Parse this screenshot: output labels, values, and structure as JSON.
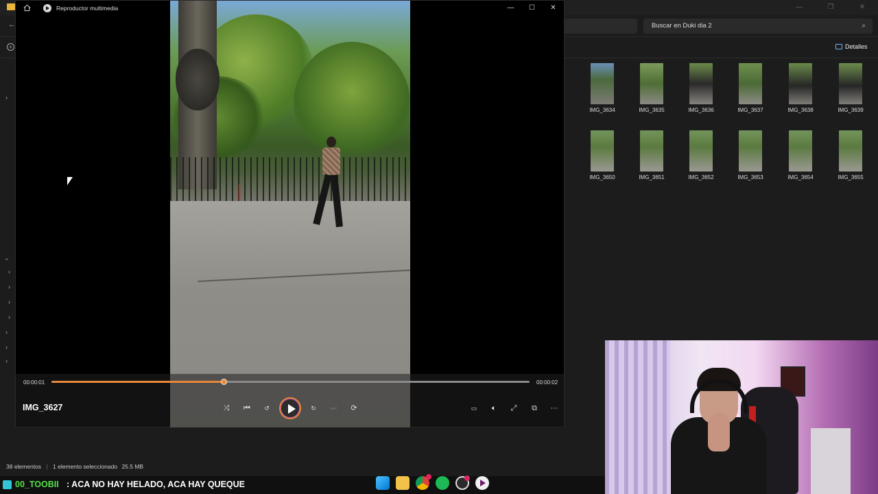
{
  "explorer": {
    "search_placeholder": "Buscar en Duki dia 2",
    "details_label": "Detalles",
    "thumbnails_row1": [
      "IMG_3634",
      "IMG_3635",
      "IMG_3636",
      "IMG_3637",
      "IMG_3638",
      "IMG_3639"
    ],
    "thumbnails_row2": [
      "IMG_3650",
      "IMG_3651",
      "IMG_3652",
      "IMG_3653",
      "IMG_3654",
      "IMG_3655"
    ],
    "status": {
      "count": "38 elementos",
      "selected": "1 elemento seleccionado",
      "size": "25.5 MB"
    }
  },
  "player": {
    "app_title": "Reproductor multimedia",
    "file_name": "IMG_3627",
    "time_current": "00:00:01",
    "time_total": "00:00:02",
    "progress_fraction": 0.36,
    "accent": "#e8883a",
    "controls": [
      "shuffle-icon",
      "previous-icon",
      "rewind-10-icon",
      "play-icon",
      "forward-30-icon",
      "next-icon",
      "repeat-icon"
    ],
    "right_controls": [
      "subtitles-icon",
      "volume-icon",
      "fullscreen-icon",
      "miniplayer-icon",
      "more-icon"
    ]
  },
  "chat": {
    "username": "00_TOOBII",
    "message": ": ACA NO HAY HELADO, ACA HAY QUEQUE"
  },
  "taskbar": {
    "icons": [
      "windows-start-icon",
      "file-explorer-icon",
      "chrome-icon",
      "spotify-icon",
      "obs-icon",
      "media-player-icon"
    ]
  }
}
